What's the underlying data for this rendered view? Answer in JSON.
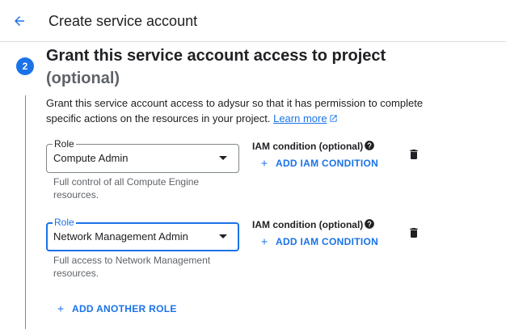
{
  "header": {
    "title": "Create service account",
    "back_icon": "arrow-back-icon"
  },
  "step": {
    "number": "2",
    "title": "Grant this service account access to project",
    "subtitle": "(optional)",
    "description": "Grant this service account access to adysur so that it has permission to complete specific actions on the resources in your project.",
    "learn_more": "Learn more"
  },
  "roles": [
    {
      "label": "Role",
      "value": "Compute Admin",
      "help": "Full control of all Compute Engine resources.",
      "iam_label": "IAM condition (optional)",
      "add_iam": "ADD IAM CONDITION"
    },
    {
      "label": "Role",
      "value": "Network Management Admin",
      "help": "Full access to Network Management resources.",
      "iam_label": "IAM condition (optional)",
      "add_iam": "ADD IAM CONDITION"
    }
  ],
  "add_another_role": "ADD ANOTHER ROLE",
  "colors": {
    "accent": "#1a73e8",
    "text": "#202124",
    "secondary_text": "#5f6368"
  }
}
